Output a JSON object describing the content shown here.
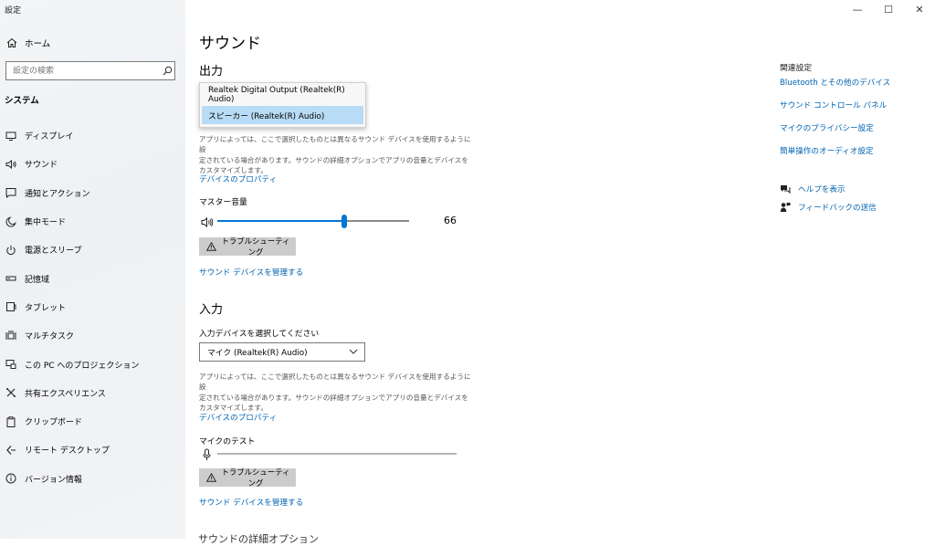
{
  "app_title": "設定",
  "window_controls": {
    "minimize": "—",
    "maximize": "☐",
    "close": "✕"
  },
  "sidebar": {
    "home_label": "ホーム",
    "search_placeholder": "設定の検索",
    "section_label": "システム",
    "items": [
      {
        "label": "ディスプレイ",
        "icon": "display-icon"
      },
      {
        "label": "サウンド",
        "icon": "speaker-icon"
      },
      {
        "label": "通知とアクション",
        "icon": "notification-icon"
      },
      {
        "label": "集中モード",
        "icon": "moon-icon"
      },
      {
        "label": "電源とスリープ",
        "icon": "power-icon"
      },
      {
        "label": "記憶域",
        "icon": "storage-icon"
      },
      {
        "label": "タブレット",
        "icon": "tablet-icon"
      },
      {
        "label": "マルチタスク",
        "icon": "multitask-icon"
      },
      {
        "label": "この PC へのプロジェクション",
        "icon": "projection-icon"
      },
      {
        "label": "共有エクスペリエンス",
        "icon": "shared-icon"
      },
      {
        "label": "クリップボード",
        "icon": "clipboard-icon"
      },
      {
        "label": "リモート デスクトップ",
        "icon": "remote-icon"
      },
      {
        "label": "バージョン情報",
        "icon": "info-icon"
      }
    ]
  },
  "main": {
    "title": "サウンド",
    "output": {
      "heading": "出力",
      "dropdown_options": [
        "Realtek Digital Output (Realtek(R) Audio)",
        "スピーカー (Realtek(R) Audio)"
      ],
      "description": [
        "アプリによっては、ここで選択したものとは異なるサウンド デバイスを使用するように設",
        "定されている場合があります。サウンドの詳細オプションでアプリの音量とデバイスを",
        "カスタマイズします。"
      ],
      "device_properties": "デバイスのプロパティ",
      "master_volume_label": "マスター音量",
      "volume": 66,
      "volume_text": "66",
      "troubleshoot": "トラブルシューティング",
      "manage_devices": "サウンド デバイスを管理する"
    },
    "input": {
      "heading": "入力",
      "select_label": "入力デバイスを選択してください",
      "selected_device": "マイク (Realtek(R) Audio)",
      "description": [
        "アプリによっては、ここで選択したものとは異なるサウンド デバイスを使用するように設",
        "定されている場合があります。サウンドの詳細オプションでアプリの音量とデバイスを",
        "カスタマイズします。"
      ],
      "device_properties": "デバイスのプロパティ",
      "mic_test_label": "マイクのテスト",
      "troubleshoot": "トラブルシューティング",
      "manage_devices": "サウンド デバイスを管理する"
    },
    "advanced_heading": "サウンドの詳細オプション"
  },
  "related": {
    "title": "関連設定",
    "links": [
      "Bluetooth とその他のデバイス",
      "サウンド コントロール パネル",
      "マイクのプライバシー設定",
      "簡単操作のオーディオ設定"
    ],
    "help": "ヘルプを表示",
    "feedback": "フィードバックの送信"
  },
  "colors": {
    "accent": "#0078d7",
    "link": "#0063b1",
    "selection": "#b8dcf5",
    "button": "#cccccc"
  }
}
